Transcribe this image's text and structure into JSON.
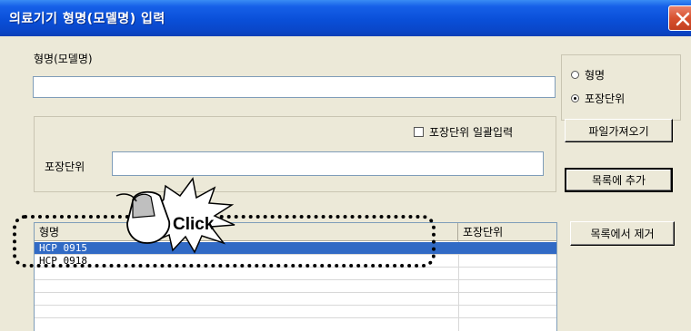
{
  "window": {
    "title": "의료기기 형명(모델명) 입력"
  },
  "model_name": {
    "label": "형명(모델명)",
    "value": ""
  },
  "radio_options": [
    {
      "label": "형명",
      "checked": false
    },
    {
      "label": "포장단위",
      "checked": true
    }
  ],
  "bulk_input": {
    "label": "포장단위 일괄입력",
    "checked": false
  },
  "package_unit": {
    "label": "포장단위",
    "value": ""
  },
  "buttons": {
    "import_file": "파일가져오기",
    "add_to_list": "목록에 추가",
    "remove_from_list": "목록에서 제거"
  },
  "list": {
    "columns": [
      "형명",
      "포장단위"
    ],
    "rows": [
      {
        "model": "HCP 0915",
        "unit": "",
        "selected": true
      },
      {
        "model": "HCP 0918",
        "unit": "",
        "selected": false
      },
      {
        "model": "",
        "unit": "",
        "selected": false
      },
      {
        "model": "",
        "unit": "",
        "selected": false
      },
      {
        "model": "",
        "unit": "",
        "selected": false
      },
      {
        "model": "",
        "unit": "",
        "selected": false
      }
    ]
  },
  "annotation": {
    "text": "Click",
    "icon": "mouse-icon"
  },
  "colors": {
    "titlebar": "#0a4fd8",
    "selection": "#316ac5",
    "dialog_bg": "#ece9d8"
  }
}
